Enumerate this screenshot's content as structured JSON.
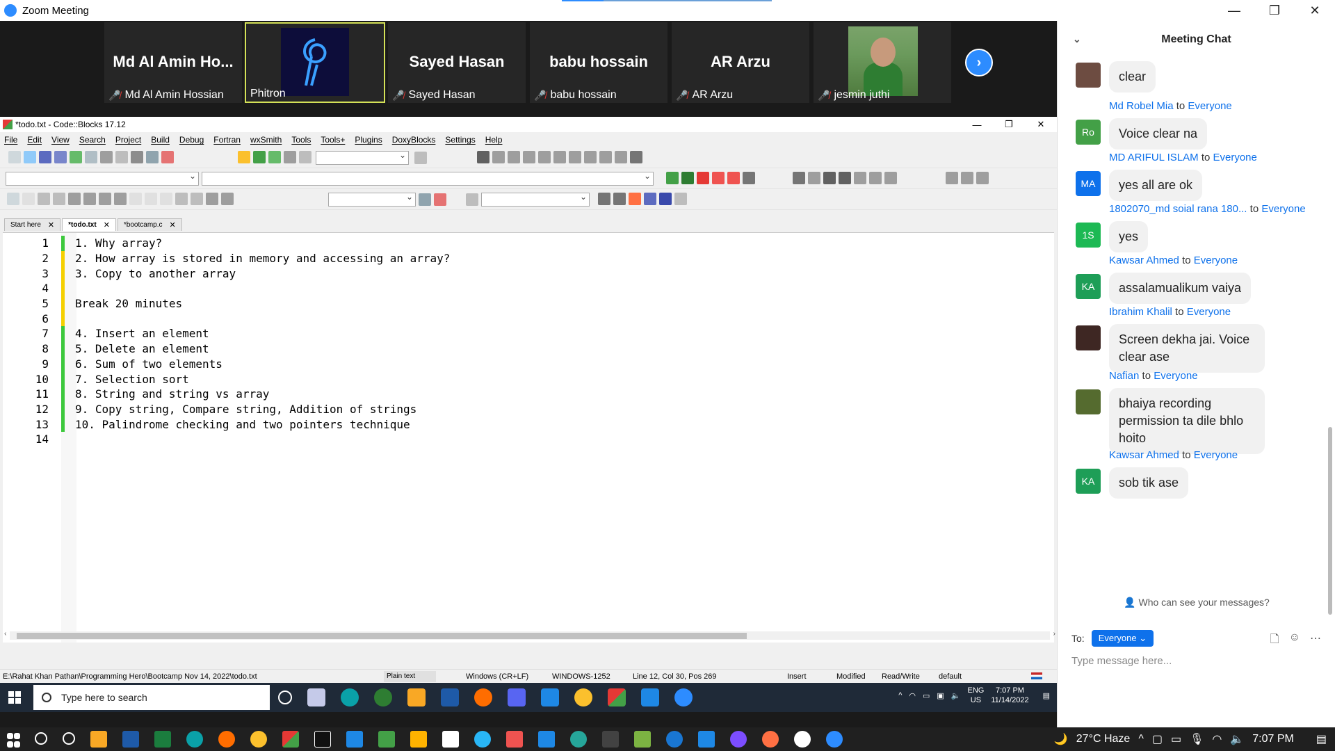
{
  "zoom": {
    "window_title": "Zoom Meeting",
    "logo_text": "zoom",
    "participants": [
      {
        "big": "Md Al Amin Ho...",
        "name": "Md Al Amin Hossian",
        "video": false
      },
      {
        "big": "",
        "name": "Phitron",
        "video": true,
        "active": true
      },
      {
        "big": "Sayed Hasan",
        "name": "Sayed Hasan",
        "video": false
      },
      {
        "big": "babu hossain",
        "name": "babu hossain",
        "video": false
      },
      {
        "big": "AR Arzu",
        "name": "AR Arzu",
        "video": false
      },
      {
        "big": "",
        "name": "jesmin juthi",
        "video": true
      }
    ],
    "window_controls": {
      "minimize": "—",
      "restore": "❐",
      "close": "✕"
    }
  },
  "codeblocks": {
    "title": "*todo.txt - Code::Blocks 17.12",
    "menu": [
      "File",
      "Edit",
      "View",
      "Search",
      "Project",
      "Build",
      "Debug",
      "Fortran",
      "wxSmith",
      "Tools",
      "Tools+",
      "Plugins",
      "DoxyBlocks",
      "Settings",
      "Help"
    ],
    "tabs": [
      {
        "label": "Start here",
        "active": false
      },
      {
        "label": "*todo.txt",
        "active": true
      },
      {
        "label": "*bootcamp.c",
        "active": false
      }
    ],
    "lines": [
      {
        "n": "1",
        "text": "1. Why array?",
        "mark": "g"
      },
      {
        "n": "2",
        "text": "2. How array is stored in memory and accessing an array?",
        "mark": "y"
      },
      {
        "n": "3",
        "text": "3. Copy to another array",
        "mark": "y"
      },
      {
        "n": "4",
        "text": "",
        "mark": "y"
      },
      {
        "n": "5",
        "text": "Break 20 minutes",
        "mark": "y"
      },
      {
        "n": "6",
        "text": "",
        "mark": "y"
      },
      {
        "n": "7",
        "text": "4. Insert an element",
        "mark": "g"
      },
      {
        "n": "8",
        "text": "5. Delete an element",
        "mark": "g"
      },
      {
        "n": "9",
        "text": "6. Sum of two elements",
        "mark": "g"
      },
      {
        "n": "10",
        "text": "7. Selection sort",
        "mark": "g"
      },
      {
        "n": "11",
        "text": "8. String and string vs array",
        "mark": "g"
      },
      {
        "n": "12",
        "text": "9. Copy string, Compare string, Addition of strings",
        "mark": "g"
      },
      {
        "n": "13",
        "text": "10. Palindrome checking and two pointers technique",
        "mark": "g"
      },
      {
        "n": "14",
        "text": "",
        "mark": "n"
      }
    ],
    "status": {
      "path": "E:\\Rahat Khan Pathan\\Programming Hero\\Bootcamp Nov 14, 2022\\todo.txt",
      "filetype": "Plain text",
      "eol": "Windows (CR+LF)",
      "encoding": "WINDOWS-1252",
      "position": "Line 12, Col 30, Pos 269",
      "mode": "Insert",
      "modified": "Modified",
      "rw": "Read/Write",
      "profile": "default"
    }
  },
  "inner_taskbar": {
    "search_placeholder": "Type here to search",
    "lang_top": "ENG",
    "lang_bottom": "US",
    "time": "7:07 PM",
    "date": "11/14/2022"
  },
  "chat": {
    "title": "Meeting Chat",
    "messages": [
      {
        "sender": "",
        "to": "",
        "avatar": "",
        "avatar_color": "#6d4c41",
        "text": "clear"
      },
      {
        "sender": "Md Robel Mia",
        "to": "Everyone",
        "avatar": "Ro",
        "avatar_color": "#43a047",
        "text": "Voice  clear  na"
      },
      {
        "sender": "MD ARIFUL ISLAM",
        "to": "Everyone",
        "avatar": "MA",
        "avatar_color": "#0e71eb",
        "text": "yes all are ok"
      },
      {
        "sender": "1802070_md soial rana 180...",
        "to": "Everyone",
        "avatar": "1S",
        "avatar_color": "#1db954",
        "text": "yes"
      },
      {
        "sender": "Kawsar Ahmed",
        "to": "Everyone",
        "avatar": "KA",
        "avatar_color": "#1e9e57",
        "text": "assalamualikum vaiya"
      },
      {
        "sender": "Ibrahim Khalil",
        "to": "Everyone",
        "avatar": "",
        "avatar_color": "#3e2723",
        "text": "Screen dekha jai. Voice clear ase"
      },
      {
        "sender": "Nafian",
        "to": "Everyone",
        "avatar": "",
        "avatar_color": "#556b2f",
        "text": "bhaiya recording permission ta dile bhlo hoito"
      },
      {
        "sender": "Kawsar Ahmed",
        "to": "Everyone",
        "avatar": "KA",
        "avatar_color": "#1e9e57",
        "text": "sob tik ase"
      }
    ],
    "to_word": "to",
    "who_can_see": "Who can see your messages?",
    "to_label": "To:",
    "to_value": "Everyone",
    "input_placeholder": "Type message here..."
  },
  "windows_taskbar": {
    "weather": "27°C  Haze",
    "time": "7:07 PM"
  }
}
